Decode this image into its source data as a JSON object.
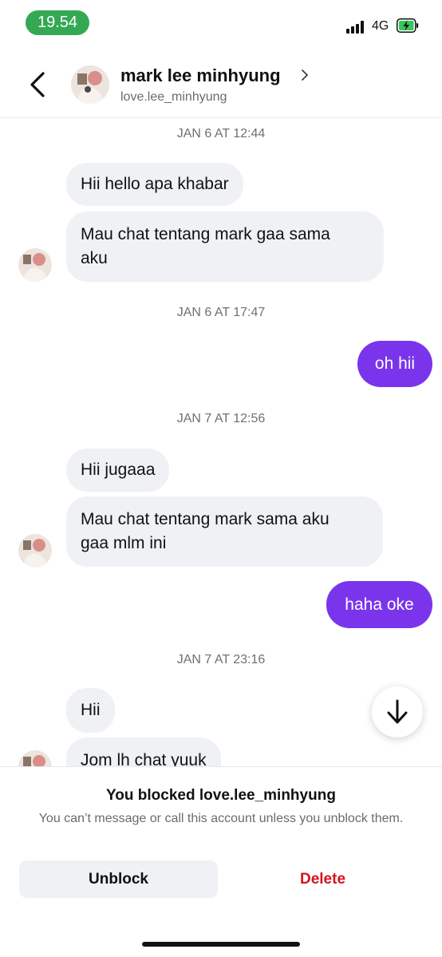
{
  "status_bar": {
    "time": "19.54",
    "network": "4G",
    "icons": [
      "signal-bars-icon",
      "battery-charging-icon"
    ],
    "time_pill_color": "#34a853"
  },
  "header": {
    "name": "mark lee minhyung",
    "handle": "love.lee_minhyung",
    "icons": [
      "back-arrow-icon",
      "chevron-right-icon"
    ]
  },
  "messages": {
    "ts1": "JAN 6 AT 12:44",
    "m1": "Hii hello apa khabar",
    "m2_line1": "Mau chat tentang mark gaa sama",
    "m2_line2": "aku",
    "ts2": "JAN 6 AT 17:47",
    "m3": "oh hii",
    "ts3": "JAN 7 AT 12:56",
    "m4": "Hii jugaaa",
    "m5_line1": "Mau chat tentang mark sama aku",
    "m5_line2": "gaa mlm ini",
    "m6": "haha oke",
    "ts4": "JAN 7 AT 23:16",
    "m7": "Hii",
    "m8": "Jom lh chat yuuk"
  },
  "colors": {
    "outgoing_bubble": "#7a35ec",
    "incoming_bubble": "#eff1f4",
    "delete": "#d3141e"
  },
  "scroll_button": {
    "icon": "arrow-down-icon"
  },
  "blocked_panel": {
    "title": "You blocked love.lee_minhyung",
    "description": "You can’t message or call this account unless you unblock them.",
    "unblock_label": "Unblock",
    "delete_label": "Delete"
  }
}
